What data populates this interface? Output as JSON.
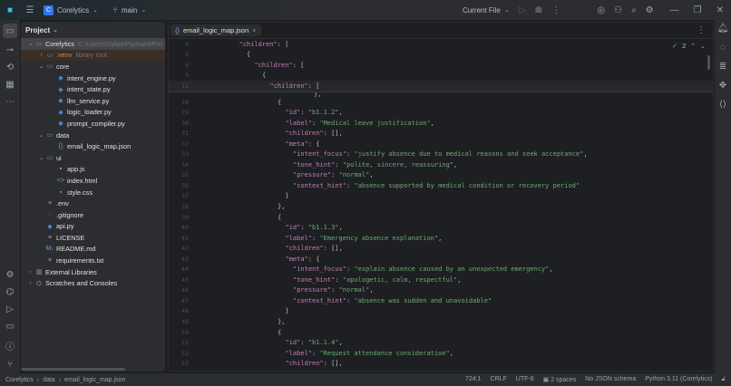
{
  "titlebar": {
    "project": "Corelytics",
    "project_initial": "C",
    "branch": "main",
    "run_config": "Current File"
  },
  "project_panel": {
    "title": "Project",
    "tree": [
      {
        "depth": 0,
        "chev": "v",
        "icon": "folder",
        "label": "Corelytics",
        "extra": "C:\\Users\\Safwa\\PycharmPro",
        "sel": true
      },
      {
        "depth": 1,
        "chev": ">",
        "icon": "folder",
        "label": ".venv",
        "extra": "library root",
        "venv": true
      },
      {
        "depth": 1,
        "chev": "v",
        "icon": "folder",
        "label": "core"
      },
      {
        "depth": 2,
        "icon": "py",
        "label": "intent_engine.py"
      },
      {
        "depth": 2,
        "icon": "py",
        "label": "intent_state.py"
      },
      {
        "depth": 2,
        "icon": "py",
        "label": "llm_service.py"
      },
      {
        "depth": 2,
        "icon": "py",
        "label": "logic_loader.py"
      },
      {
        "depth": 2,
        "icon": "py",
        "label": "prompt_compiler.py"
      },
      {
        "depth": 1,
        "chev": "v",
        "icon": "folder",
        "label": "data"
      },
      {
        "depth": 2,
        "icon": "json",
        "label": "email_logic_map.json"
      },
      {
        "depth": 1,
        "chev": "v",
        "icon": "folder",
        "label": "ui"
      },
      {
        "depth": 2,
        "icon": "js",
        "label": "app.js"
      },
      {
        "depth": 2,
        "icon": "html",
        "label": "index.html"
      },
      {
        "depth": 2,
        "icon": "css",
        "label": "style.css"
      },
      {
        "depth": 1,
        "icon": "env",
        "label": ".env"
      },
      {
        "depth": 1,
        "icon": "git",
        "label": ".gitignore"
      },
      {
        "depth": 1,
        "icon": "py",
        "label": "api.py"
      },
      {
        "depth": 1,
        "icon": "txt",
        "label": "LICENSE"
      },
      {
        "depth": 1,
        "icon": "md",
        "label": "README.md"
      },
      {
        "depth": 1,
        "icon": "txt",
        "label": "requirements.txt"
      },
      {
        "depth": 0,
        "chev": ">",
        "icon": "lib",
        "label": "External Libraries"
      },
      {
        "depth": 0,
        "chev": ">",
        "icon": "scratch",
        "label": "Scratches and Consoles"
      }
    ]
  },
  "editor": {
    "tab": "email_logic_map.json",
    "inspections": "2",
    "sticky": [
      {
        "n": "4",
        "i": 3,
        "parts": [
          [
            "k",
            "\"children\""
          ],
          [
            "p",
            ": ["
          ]
        ]
      },
      {
        "n": "5",
        "i": 4,
        "parts": [
          [
            "p",
            "{"
          ]
        ]
      },
      {
        "n": "8",
        "i": 5,
        "parts": [
          [
            "k",
            "\"children\""
          ],
          [
            "p",
            ": ["
          ]
        ]
      },
      {
        "n": "9",
        "i": 6,
        "parts": [
          [
            "p",
            "{"
          ]
        ]
      },
      {
        "n": "12",
        "i": 7,
        "parts": [
          [
            "k",
            "\"children\""
          ],
          [
            "p",
            ": ["
          ]
        ],
        "cur": true
      }
    ],
    "lines": [
      {
        "n": "28",
        "i": 8,
        "parts": [
          [
            "p",
            "{"
          ]
        ]
      },
      {
        "n": "29",
        "i": 9,
        "parts": [
          [
            "k",
            "\"id\""
          ],
          [
            "p",
            ": "
          ],
          [
            "s",
            "\"b1.1.2\""
          ],
          [
            "p",
            ","
          ]
        ]
      },
      {
        "n": "30",
        "i": 9,
        "parts": [
          [
            "k",
            "\"label\""
          ],
          [
            "p",
            ": "
          ],
          [
            "s",
            "\"Medical leave justification\""
          ],
          [
            "p",
            ","
          ]
        ]
      },
      {
        "n": "31",
        "i": 9,
        "parts": [
          [
            "k",
            "\"children\""
          ],
          [
            "p",
            ": [],"
          ]
        ]
      },
      {
        "n": "32",
        "i": 9,
        "parts": [
          [
            "k",
            "\"meta\""
          ],
          [
            "p",
            ": {"
          ]
        ]
      },
      {
        "n": "33",
        "i": 10,
        "parts": [
          [
            "k",
            "\"intent_focus\""
          ],
          [
            "p",
            ": "
          ],
          [
            "s",
            "\"justify absence due to medical reasons and seek acceptance\""
          ],
          [
            "p",
            ","
          ]
        ]
      },
      {
        "n": "34",
        "i": 10,
        "parts": [
          [
            "k",
            "\"tone_hint\""
          ],
          [
            "p",
            ": "
          ],
          [
            "s",
            "\"polite, sincere, reassuring\""
          ],
          [
            "p",
            ","
          ]
        ]
      },
      {
        "n": "35",
        "i": 10,
        "parts": [
          [
            "k",
            "\"pressure\""
          ],
          [
            "p",
            ": "
          ],
          [
            "s",
            "\"normal\""
          ],
          [
            "p",
            ","
          ]
        ]
      },
      {
        "n": "36",
        "i": 10,
        "parts": [
          [
            "k",
            "\"context_hint\""
          ],
          [
            "p",
            ": "
          ],
          [
            "s",
            "\"absence supported by medical condition or recovery period\""
          ]
        ]
      },
      {
        "n": "37",
        "i": 9,
        "parts": [
          [
            "p",
            "}"
          ]
        ]
      },
      {
        "n": "38",
        "i": 8,
        "parts": [
          [
            "p",
            "},"
          ]
        ]
      },
      {
        "n": "39",
        "i": 8,
        "parts": [
          [
            "p",
            "{"
          ]
        ]
      },
      {
        "n": "40",
        "i": 9,
        "parts": [
          [
            "k",
            "\"id\""
          ],
          [
            "p",
            ": "
          ],
          [
            "s",
            "\"b1.1.3\""
          ],
          [
            "p",
            ","
          ]
        ]
      },
      {
        "n": "41",
        "i": 9,
        "parts": [
          [
            "k",
            "\"label\""
          ],
          [
            "p",
            ": "
          ],
          [
            "s",
            "\"Emergency absence explanation\""
          ],
          [
            "p",
            ","
          ]
        ]
      },
      {
        "n": "42",
        "i": 9,
        "parts": [
          [
            "k",
            "\"children\""
          ],
          [
            "p",
            ": [],"
          ]
        ]
      },
      {
        "n": "43",
        "i": 9,
        "parts": [
          [
            "k",
            "\"meta\""
          ],
          [
            "p",
            ": {"
          ]
        ]
      },
      {
        "n": "44",
        "i": 10,
        "parts": [
          [
            "k",
            "\"intent_focus\""
          ],
          [
            "p",
            ": "
          ],
          [
            "s",
            "\"explain absence caused by an unexpected emergency\""
          ],
          [
            "p",
            ","
          ]
        ]
      },
      {
        "n": "45",
        "i": 10,
        "parts": [
          [
            "k",
            "\"tone_hint\""
          ],
          [
            "p",
            ": "
          ],
          [
            "s",
            "\"apologetic, calm, respectful\""
          ],
          [
            "p",
            ","
          ]
        ]
      },
      {
        "n": "46",
        "i": 10,
        "parts": [
          [
            "k",
            "\"pressure\""
          ],
          [
            "p",
            ": "
          ],
          [
            "s",
            "\"normal\""
          ],
          [
            "p",
            ","
          ]
        ]
      },
      {
        "n": "47",
        "i": 10,
        "parts": [
          [
            "k",
            "\"context_hint\""
          ],
          [
            "p",
            ": "
          ],
          [
            "s",
            "\"absence was sudden and unavoidable\""
          ]
        ]
      },
      {
        "n": "48",
        "i": 9,
        "parts": [
          [
            "p",
            "}"
          ]
        ]
      },
      {
        "n": "49",
        "i": 8,
        "parts": [
          [
            "p",
            "},"
          ]
        ]
      },
      {
        "n": "50",
        "i": 8,
        "parts": [
          [
            "p",
            "{"
          ]
        ]
      },
      {
        "n": "51",
        "i": 9,
        "parts": [
          [
            "k",
            "\"id\""
          ],
          [
            "p",
            ": "
          ],
          [
            "s",
            "\"b1.1.4\""
          ],
          [
            "p",
            ","
          ]
        ]
      },
      {
        "n": "52",
        "i": 9,
        "parts": [
          [
            "k",
            "\"label\""
          ],
          [
            "p",
            ": "
          ],
          [
            "s",
            "\"Request attendance consideration\""
          ],
          [
            "p",
            ","
          ]
        ]
      },
      {
        "n": "53",
        "i": 9,
        "parts": [
          [
            "k",
            "\"children\""
          ],
          [
            "p",
            ": [],"
          ]
        ]
      }
    ]
  },
  "statusbar": {
    "breadcrumb": [
      "Corelytics",
      "data",
      "email_logic_map.json"
    ],
    "position": "724:1",
    "line_sep": "CRLF",
    "encoding": "UTF-8",
    "indent": "2 spaces",
    "schema": "No JSON schema",
    "interpreter": "Python 3.11 (Corelytics)"
  }
}
